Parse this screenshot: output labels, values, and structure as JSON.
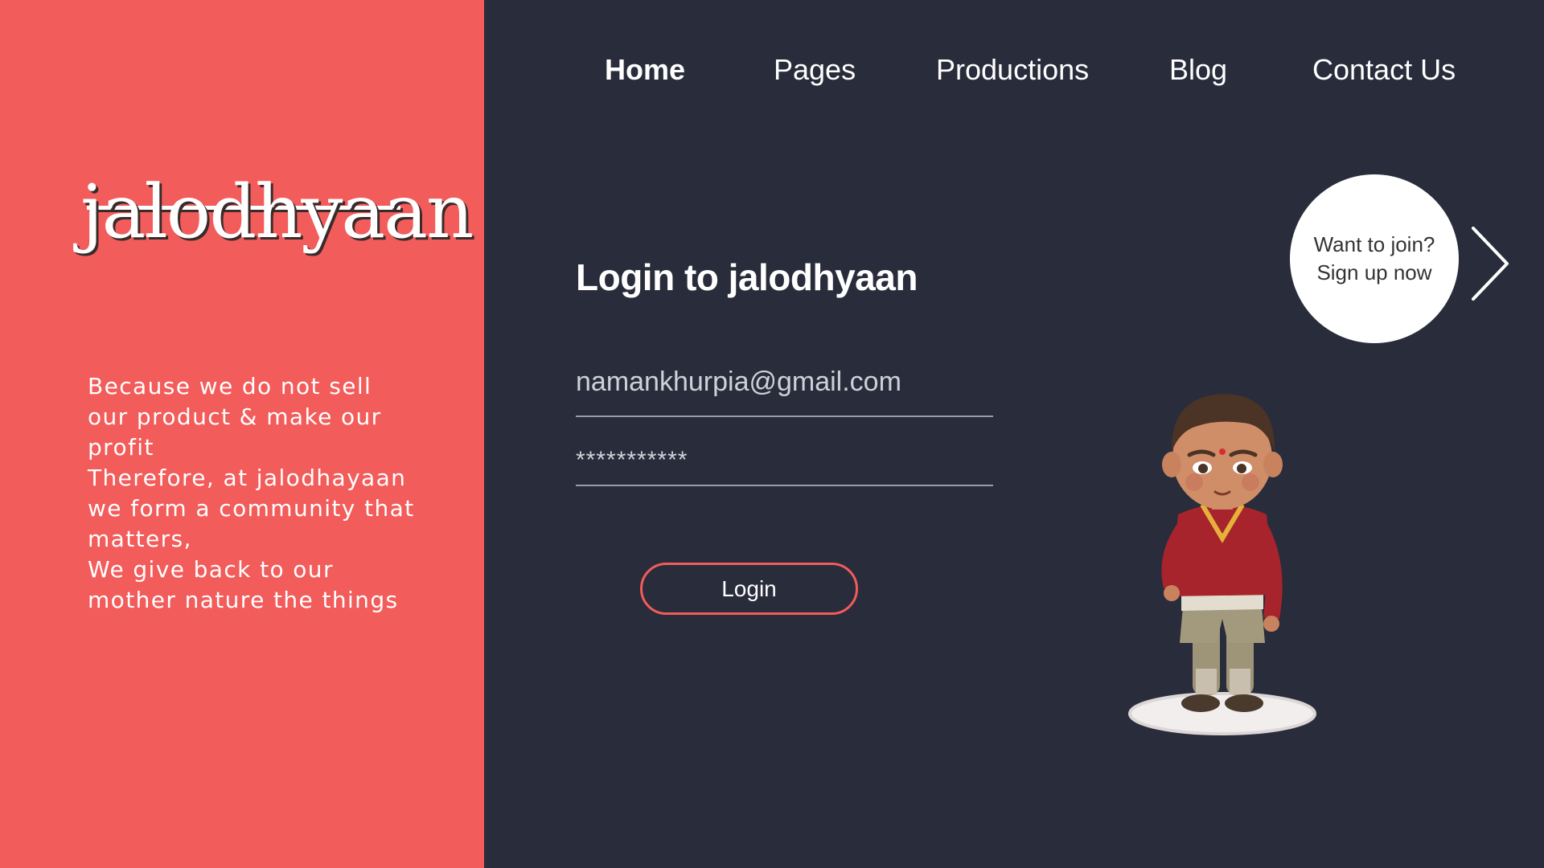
{
  "brand": {
    "logo_text": "jalodhyaan"
  },
  "tagline": {
    "lines": [
      "Because we do not sell",
      "our product & make our",
      "profit",
      "Therefore, at jalodhayaan",
      "we form a community that",
      "matters,",
      "We give back to our",
      "mother nature the things"
    ]
  },
  "nav": {
    "items": [
      {
        "label": "Home",
        "active": true
      },
      {
        "label": "Pages",
        "active": false
      },
      {
        "label": "Productions",
        "active": false
      },
      {
        "label": "Blog",
        "active": false
      },
      {
        "label": "Contact Us",
        "active": false
      }
    ]
  },
  "login": {
    "title": "Login to jalodhyaan",
    "email_value": "namankhurpia@gmail.com",
    "password_value": "***********",
    "button_label": "Login"
  },
  "signup": {
    "line1": "Want to join?",
    "line2": "Sign up now",
    "arrow_icon": "chevron-right-icon"
  },
  "colors": {
    "left_panel": "#f25c5a",
    "background": "#292c3b",
    "accent": "#f25c5a"
  }
}
